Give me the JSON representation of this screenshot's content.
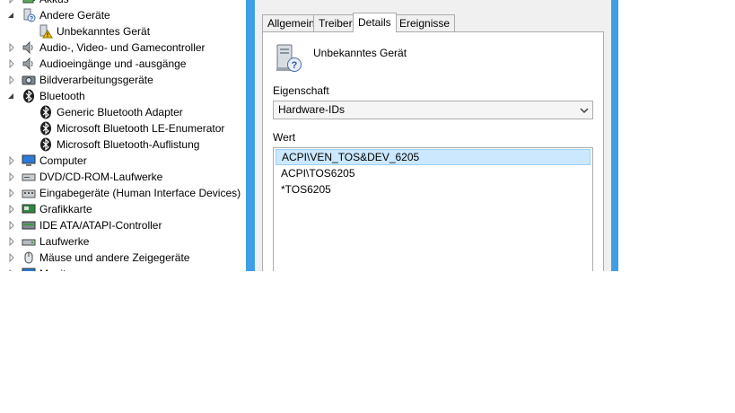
{
  "device_tree": [
    {
      "label": "Akkus",
      "icon": "battery-icon",
      "expander": "collapsed",
      "level": 0
    },
    {
      "label": "Andere Geräte",
      "icon": "unknown-devices-icon",
      "expander": "expanded",
      "level": 0
    },
    {
      "label": "Unbekanntes Gerät",
      "icon": "unknown-device-warning-icon",
      "expander": "none",
      "level": 1
    },
    {
      "label": "Audio-, Video- und Gamecontroller",
      "icon": "speaker-icon",
      "expander": "collapsed",
      "level": 0
    },
    {
      "label": "Audioeingänge und -ausgänge",
      "icon": "speaker-icon",
      "expander": "collapsed",
      "level": 0
    },
    {
      "label": "Bildverarbeitungsgeräte",
      "icon": "camera-icon",
      "expander": "collapsed",
      "level": 0
    },
    {
      "label": "Bluetooth",
      "icon": "bluetooth-icon",
      "expander": "expanded",
      "level": 0
    },
    {
      "label": "Generic Bluetooth Adapter",
      "icon": "bluetooth-icon",
      "expander": "none",
      "level": 1
    },
    {
      "label": "Microsoft Bluetooth LE-Enumerator",
      "icon": "bluetooth-icon",
      "expander": "none",
      "level": 1
    },
    {
      "label": "Microsoft Bluetooth-Auflistung",
      "icon": "bluetooth-icon",
      "expander": "none",
      "level": 1
    },
    {
      "label": "Computer",
      "icon": "computer-icon",
      "expander": "collapsed",
      "level": 0
    },
    {
      "label": "DVD/CD-ROM-Laufwerke",
      "icon": "dvd-drive-icon",
      "expander": "collapsed",
      "level": 0
    },
    {
      "label": "Eingabegeräte (Human Interface Devices)",
      "icon": "hid-icon",
      "expander": "collapsed",
      "level": 0
    },
    {
      "label": "Grafikkarte",
      "icon": "display-adapter-icon",
      "expander": "collapsed",
      "level": 0
    },
    {
      "label": "IDE ATA/ATAPI-Controller",
      "icon": "ide-controller-icon",
      "expander": "collapsed",
      "level": 0
    },
    {
      "label": "Laufwerke",
      "icon": "disk-drive-icon",
      "expander": "collapsed",
      "level": 0
    },
    {
      "label": "Mäuse und andere Zeigegeräte",
      "icon": "mouse-icon",
      "expander": "collapsed",
      "level": 0
    },
    {
      "label": "Monitore",
      "icon": "monitor-icon",
      "expander": "collapsed",
      "level": 0
    }
  ],
  "dialog": {
    "tabs": [
      {
        "label": "Allgemein",
        "active": false
      },
      {
        "label": "Treiber",
        "active": false
      },
      {
        "label": "Details",
        "active": true
      },
      {
        "label": "Ereignisse",
        "active": false
      }
    ],
    "device_name": "Unbekanntes Gerät",
    "device_icon": "unknown-device-icon",
    "property_label": "Eigenschaft",
    "property_value": "Hardware-IDs",
    "value_label": "Wert",
    "values": [
      {
        "text": "ACPI\\VEN_TOS&DEV_6205",
        "selected": true
      },
      {
        "text": "ACPI\\TOS6205",
        "selected": false
      },
      {
        "text": "*TOS6205",
        "selected": false
      }
    ]
  },
  "colors": {
    "window_frame": "#3f9fe6",
    "selection_bg": "#cce8ff",
    "selection_border": "#99d1ff",
    "dialog_bg": "#f0f0f0"
  }
}
